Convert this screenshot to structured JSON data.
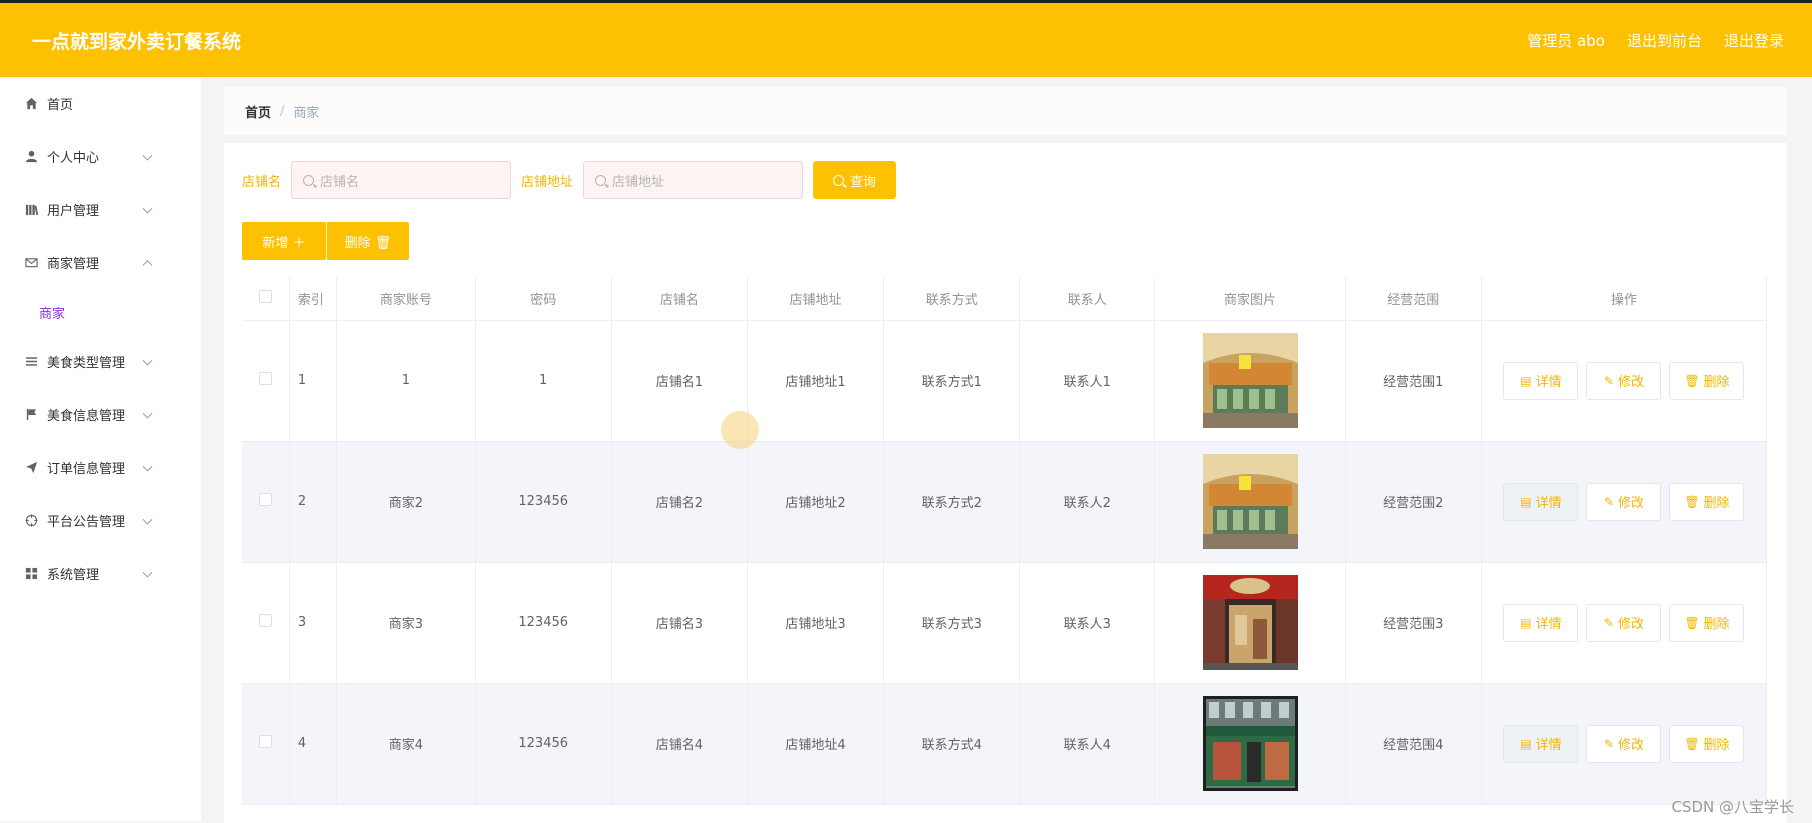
{
  "header": {
    "title": "一点就到家外卖订餐系统",
    "links": [
      "管理员 abo",
      "退出到前台",
      "退出登录"
    ]
  },
  "sidebar": {
    "items": [
      {
        "label": "首页",
        "icon": "home-icon",
        "expandable": false
      },
      {
        "label": "个人中心",
        "icon": "user-icon",
        "expandable": true
      },
      {
        "label": "用户管理",
        "icon": "library-icon",
        "expandable": true
      },
      {
        "label": "商家管理",
        "icon": "mail-icon",
        "expandable": true,
        "expanded": true,
        "children": [
          "商家"
        ]
      },
      {
        "label": "美食类型管理",
        "icon": "list-icon",
        "expandable": true
      },
      {
        "label": "美食信息管理",
        "icon": "flag-icon",
        "expandable": true
      },
      {
        "label": "订单信息管理",
        "icon": "send-icon",
        "expandable": true
      },
      {
        "label": "平台公告管理",
        "icon": "target-icon",
        "expandable": true
      },
      {
        "label": "系统管理",
        "icon": "grid-icon",
        "expandable": true
      }
    ]
  },
  "breadcrumb": {
    "home": "首页",
    "separator": "/",
    "current": "商家"
  },
  "search": {
    "shop_name_label": "店铺名",
    "shop_name_placeholder": "店铺名",
    "shop_address_label": "店铺地址",
    "shop_address_placeholder": "店铺地址",
    "query_button": "查询"
  },
  "actions": {
    "add": "新增 ＋",
    "delete": "删除 🗑"
  },
  "table": {
    "headers": [
      "",
      "索引",
      "商家账号",
      "密码",
      "店铺名",
      "店铺地址",
      "联系方式",
      "联系人",
      "商家图片",
      "经营范围",
      "操作"
    ],
    "rows": [
      {
        "index": "1",
        "account": "1",
        "password": "1",
        "shop": "店铺名1",
        "address": "店铺地址1",
        "contact": "联系方式1",
        "person": "联系人1",
        "scope": "经营范围1"
      },
      {
        "index": "2",
        "account": "商家2",
        "password": "123456",
        "shop": "店铺名2",
        "address": "店铺地址2",
        "contact": "联系方式2",
        "person": "联系人2",
        "scope": "经营范围2"
      },
      {
        "index": "3",
        "account": "商家3",
        "password": "123456",
        "shop": "店铺名3",
        "address": "店铺地址3",
        "contact": "联系方式3",
        "person": "联系人3",
        "scope": "经营范围3"
      },
      {
        "index": "4",
        "account": "商家4",
        "password": "123456",
        "shop": "店铺名4",
        "address": "店铺地址4",
        "contact": "联系方式4",
        "person": "联系人4",
        "scope": "经营范围4"
      }
    ],
    "op_labels": {
      "detail": "详情",
      "edit": "修改",
      "delete": "删除"
    }
  },
  "watermark": "CSDN @八宝学长",
  "colors": {
    "accent": "#fdc101",
    "label": "#f2b600",
    "active_sub": "#8a2be2"
  }
}
